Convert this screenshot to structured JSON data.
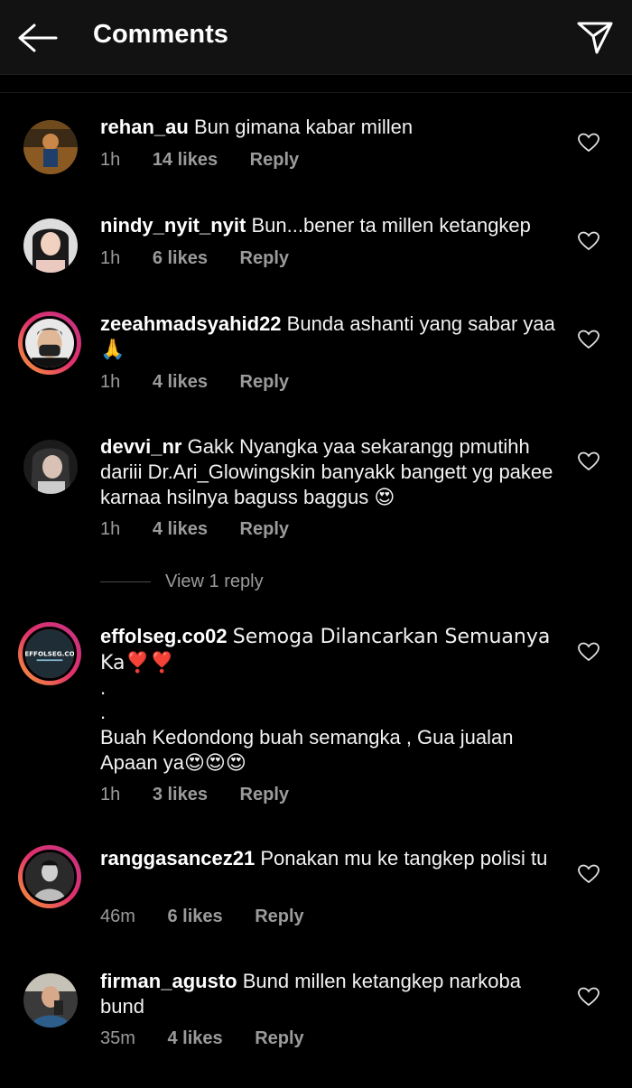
{
  "header": {
    "title": "Comments",
    "back_icon": "arrow-left-icon",
    "share_icon": "paper-plane-icon"
  },
  "comments": [
    {
      "user": "rehan_au",
      "text": "Bun gimana kabar millen",
      "time": "1h",
      "likes": "14 likes",
      "reply": "Reply",
      "ring": false
    },
    {
      "user": "nindy_nyit_nyit",
      "text": "Bun...bener ta millen ketangkep",
      "time": "1h",
      "likes": "6 likes",
      "reply": "Reply",
      "ring": false
    },
    {
      "user": "zeeahmadsyahid22",
      "text": "Bunda ashanti yang sabar yaa 🙏",
      "time": "1h",
      "likes": "4 likes",
      "reply": "Reply",
      "ring": true
    },
    {
      "user": "devvi_nr",
      "text": "Gakk Nyangka yaa sekarangg pmutihh dariii Dr.Ari_Glowingskin banyakk bangett yg pakee karnaa hsilnya baguss baggus 😍",
      "time": "1h",
      "likes": "4 likes",
      "reply": "Reply",
      "ring": false,
      "view_replies": "View 1 reply"
    },
    {
      "user": "effolseg.co02",
      "text": "Semoga Dilancarkan Semuanya Ka❣️❣️",
      "text_dot1": ".",
      "text_dot2": ".",
      "text_extra": "Buah Kedondong buah semangka , Gua jualan Apaan ya😍😍😍",
      "time": "1h",
      "likes": "3 likes",
      "reply": "Reply",
      "ring": true,
      "avatar_text": "EFFOLSEG.CO"
    },
    {
      "user": "ranggasancez21",
      "text": "Ponakan mu ke tangkep polisi tu",
      "time": "46m",
      "likes": "6 likes",
      "reply": "Reply",
      "ring": true
    },
    {
      "user": "firman_agusto",
      "text": "Bund millen ketangkep narkoba bund",
      "time": "35m",
      "likes": "4 likes",
      "reply": "Reply",
      "ring": false
    }
  ],
  "colors": {
    "background": "#000000",
    "header": "#121212",
    "meta": "#9b9b9b",
    "ring_start": "#f7a035",
    "ring_end": "#c13584"
  }
}
